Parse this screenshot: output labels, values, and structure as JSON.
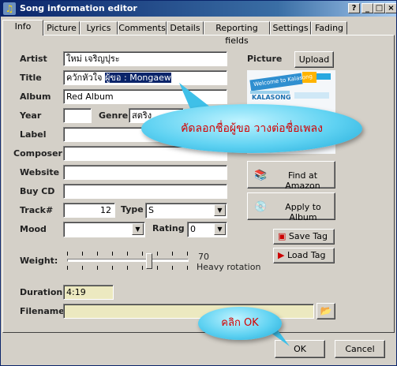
{
  "window": {
    "title": "Song information editor",
    "app_icon": "music-note-icon"
  },
  "titlebar_buttons": {
    "help": "?",
    "minimize": "_",
    "maximize": "□",
    "close": "×"
  },
  "tabs": [
    {
      "label": "Info",
      "active": true
    },
    {
      "label": "Picture"
    },
    {
      "label": "Lyrics"
    },
    {
      "label": "Comments"
    },
    {
      "label": "Details"
    },
    {
      "label": "Reporting fields"
    },
    {
      "label": "Settings"
    },
    {
      "label": "Fading"
    }
  ],
  "fields": {
    "artist": {
      "label": "Artist",
      "value": "ใหม่ เจริญปุระ"
    },
    "title": {
      "label": "Title",
      "value_plain": "ควักหัวใจ ",
      "value_selected": "ผู้ขอ : Mongaew"
    },
    "album": {
      "label": "Album",
      "value": "Red Album"
    },
    "year": {
      "label": "Year",
      "value": ""
    },
    "genre": {
      "label": "Genre",
      "value": "สตริง"
    },
    "label": {
      "label": "Label",
      "value": ""
    },
    "composer": {
      "label": "Composer",
      "value": ""
    },
    "website": {
      "label": "Website",
      "value": ""
    },
    "buy_cd": {
      "label": "Buy CD",
      "value": ""
    },
    "track": {
      "label": "Track#",
      "value": "12"
    },
    "type": {
      "label": "Type",
      "value": "S"
    },
    "mood": {
      "label": "Mood",
      "value": ""
    },
    "rating": {
      "label": "Rating",
      "value": "0"
    },
    "weight": {
      "label": "Weight:",
      "value": "70",
      "caption": "Heavy rotation",
      "level": 70
    },
    "duration": {
      "label": "Duration",
      "value": "4:19"
    },
    "filename": {
      "label": "Filename",
      "value": ""
    }
  },
  "picture": {
    "label": "Picture",
    "upload_label": "Upload",
    "cover_line1": "Welcome to Kalasong",
    "cover_line2": "KALASONG"
  },
  "side_buttons": {
    "amazon": "Find at Amazon",
    "apply_album": "Apply to Album",
    "save_tag": "Save Tag",
    "load_tag": "Load Tag"
  },
  "annotations": {
    "copy_hint": "คัดลอกชื่อผู้ขอ วางต่อชื่อเพลง",
    "ok_hint": "คลิก OK"
  },
  "footer": {
    "ok_label": "OK",
    "cancel_label": "Cancel"
  },
  "colors": {
    "title_bar": "#0a246a",
    "bubble": "#5fd2f2",
    "bubble_text": "#d50000",
    "selection": "#0a246a"
  }
}
